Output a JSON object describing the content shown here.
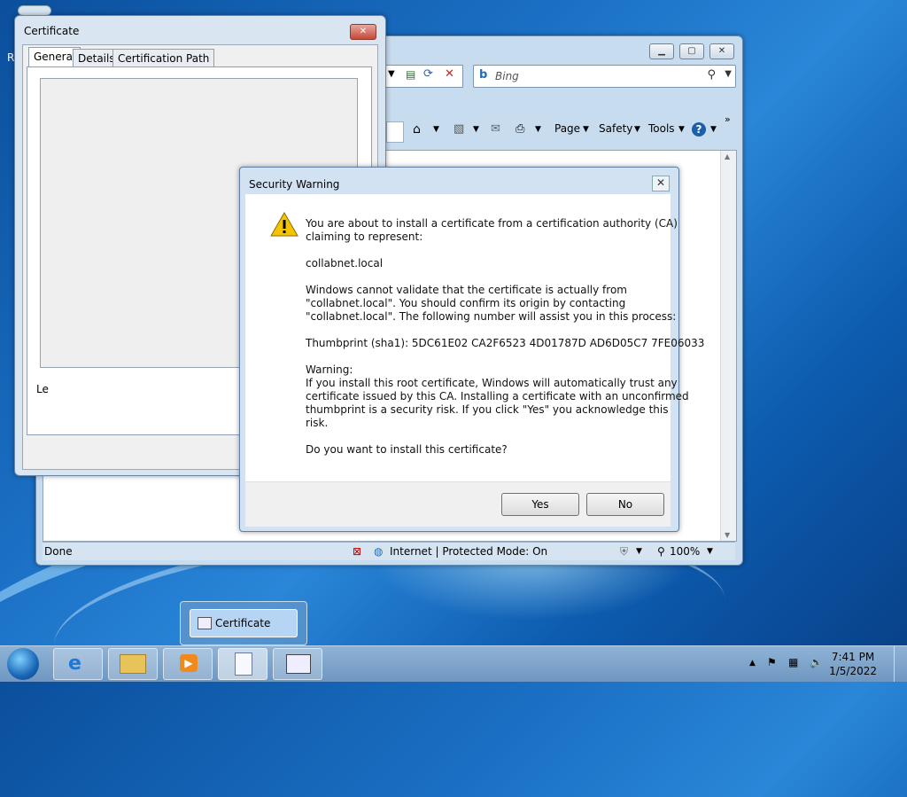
{
  "desktop": {
    "label": "R"
  },
  "ie": {
    "search": {
      "placeholder": "Bing"
    },
    "commands": {
      "page": "Page",
      "safety": "Safety",
      "tools": "Tools"
    },
    "status": {
      "left": "Done",
      "zone": "Internet | Protected Mode: On",
      "zoom": "100%"
    }
  },
  "certificate": {
    "title": "Certificate",
    "tabs": [
      "General",
      "Details",
      "Certification Path"
    ],
    "fragment": "Le"
  },
  "security_warning": {
    "title": "Security Warning",
    "intro_line1": "You are about to install a certificate from a certification authority (CA)",
    "intro_line2": "claiming to represent:",
    "domain": "collabnet.local",
    "validate_line1": "Windows cannot validate that the certificate is actually from",
    "validate_line2": "\"collabnet.local\". You should confirm its origin by contacting",
    "validate_line3": "\"collabnet.local\". The following number will assist you in this process:",
    "thumbprint": "Thumbprint (sha1): 5DC61E02 CA2F6523 4D01787D AD6D05C7 7FE06033",
    "warning_head": "Warning:",
    "warning_line1": "If you install this root certificate, Windows will automatically trust any",
    "warning_line2": "certificate issued by this CA. Installing a certificate with an unconfirmed",
    "warning_line3": "thumbprint is a security risk. If you click \"Yes\" you acknowledge this",
    "warning_line4": "risk.",
    "question": "Do you want to install this certificate?",
    "yes": "Yes",
    "no": "No"
  },
  "taskbar": {
    "thumb_label": "Certificate",
    "time": "7:41 PM",
    "date": "1/5/2022"
  }
}
